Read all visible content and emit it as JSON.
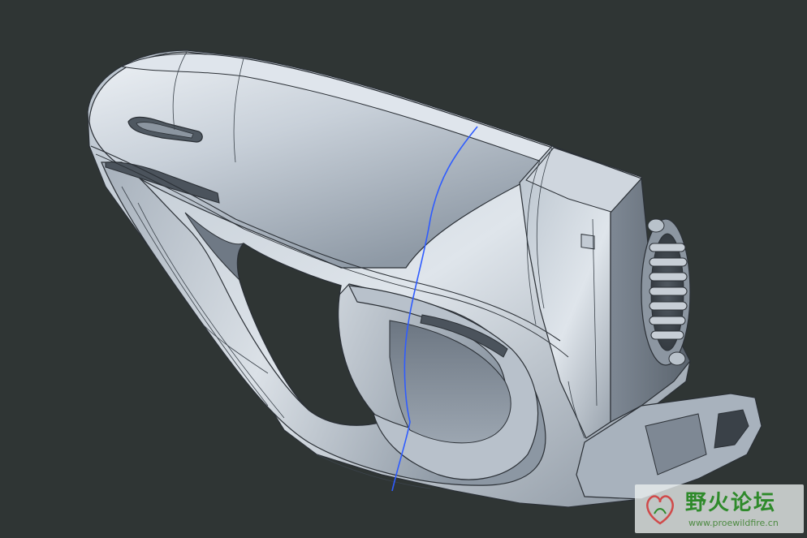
{
  "watermark": {
    "title": "野火论坛",
    "url": "www.proewildfire.cn"
  },
  "colors": {
    "background": "#2f3534",
    "model_light": "#d4dbe3",
    "model_mid": "#9aa5b0",
    "model_dark": "#56606a",
    "edge": "#2b3036",
    "datum_curve": "#2f5cff",
    "watermark_green": "#2e8a2a"
  }
}
